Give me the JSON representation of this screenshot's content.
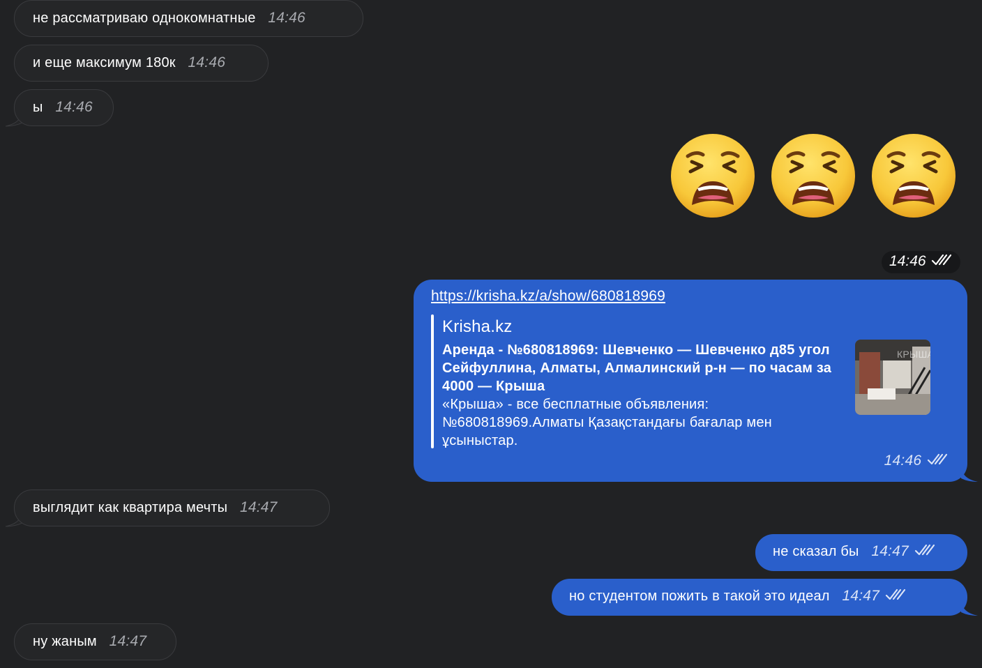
{
  "messages": {
    "m1": {
      "text": "не рассматриваю однокомнатные",
      "time": "14:46"
    },
    "m2": {
      "text": "и еще максимум 180к",
      "time": "14:46"
    },
    "m3": {
      "text": "ы",
      "time": "14:46"
    },
    "sticker": {
      "emoji": "weary-face",
      "count": 3,
      "time": "14:46"
    },
    "link_msg": {
      "url": "https://krisha.kz/a/show/680818969",
      "site": "Krisha.kz",
      "title": "Аренда - №680818969: Шевченко — Шевченко д85 угол Сейфуллина, Алматы, Алмалинский р-н — по часам за 4000 — Крыша",
      "description": "«Крыша» - все бесплатные объявления: №680818969.Алматы Қазақстандағы бағалар мен ұсыныстар.",
      "time": "14:46"
    },
    "m5": {
      "text": "выглядит как квартира мечты",
      "time": "14:47"
    },
    "m6": {
      "text": "не сказал бы",
      "time": "14:47"
    },
    "m7": {
      "text": "но студентом пожить в такой это идеал",
      "time": "14:47"
    },
    "m8": {
      "text": "ну жаным",
      "time": "14:47"
    }
  },
  "colors": {
    "background": "#212224",
    "incoming_bubble": "#252628",
    "outgoing_bubble": "#2a5fcb"
  }
}
